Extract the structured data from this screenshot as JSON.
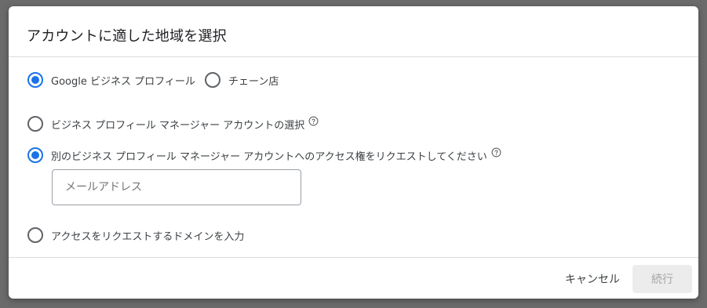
{
  "dialog": {
    "title": "アカウントに適した地域を選択"
  },
  "account_type": {
    "options": [
      {
        "label": "Google ビジネス プロフィール",
        "checked": true
      },
      {
        "label": "チェーン店",
        "checked": false
      }
    ]
  },
  "access_options": [
    {
      "label": "ビジネス プロフィール マネージャー アカウントの選択",
      "checked": false,
      "help_icon": "help-circle-icon"
    },
    {
      "label": "別のビジネス プロフィール マネージャー アカウントへのアクセス権をリクエストしてください",
      "checked": true,
      "help_icon": "help-circle-icon"
    },
    {
      "label": "アクセスをリクエストするドメインを入力",
      "checked": false
    }
  ],
  "email_input": {
    "placeholder": "メールアドレス",
    "value": ""
  },
  "footer": {
    "cancel_label": "キャンセル",
    "continue_label": "続行",
    "continue_disabled": true
  },
  "colors": {
    "accent": "#1a73e8",
    "text": "#3c4043",
    "divider": "#dadce0",
    "disabled_bg": "#ececec",
    "disabled_text": "#a5a5a5",
    "backdrop": "#6b6b6b"
  }
}
